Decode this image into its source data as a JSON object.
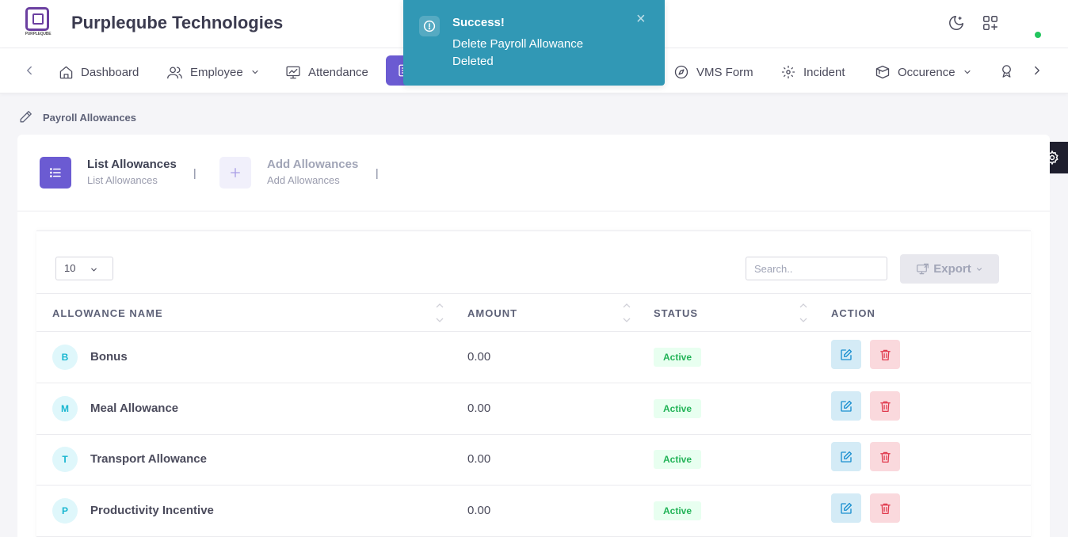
{
  "header": {
    "logo_text": "PURPLEQUBE",
    "company_name": "Purpleqube Technologies",
    "icons": [
      "moon-icon",
      "apps-grid-icon"
    ],
    "online_status_color": "#22c55e"
  },
  "nav": {
    "items": [
      {
        "label": "Dashboard",
        "icon": "home-icon",
        "has_dropdown": false
      },
      {
        "label": "Employee",
        "icon": "users-icon",
        "has_dropdown": true
      },
      {
        "label": "Attendance",
        "icon": "monitor-chart-icon",
        "has_dropdown": false
      },
      {
        "label": "",
        "icon": "payroll-icon",
        "active": true
      },
      {
        "label": "VMS Form",
        "icon": "compass-icon",
        "has_dropdown": false
      },
      {
        "label": "Incident",
        "icon": "scan-icon",
        "has_dropdown": false
      },
      {
        "label": "Occurence",
        "icon": "box-icon",
        "has_dropdown": true
      }
    ],
    "active_color": "#6b5bd2"
  },
  "toast": {
    "title": "Success!",
    "message": "Delete Payroll Allowance Deleted",
    "close": "×",
    "color": "#3198b5"
  },
  "breadcrumb": {
    "label": "Payroll Allowances"
  },
  "tabs": [
    {
      "title": "List Allowances",
      "subtitle": "List Allowances",
      "icon": "list-icon",
      "active": true
    },
    {
      "title": "Add Allowances",
      "subtitle": "Add Allowances",
      "icon": "plus-icon",
      "active": false
    }
  ],
  "tab_separator": "|",
  "table": {
    "page_length": "10",
    "search_placeholder": "Search..",
    "export_label": "Export",
    "columns": [
      "ALLOWANCE NAME",
      "AMOUNT",
      "STATUS",
      "ACTION"
    ],
    "rows": [
      {
        "initial": "B",
        "name": "Bonus",
        "amount": "0.00",
        "status": "Active"
      },
      {
        "initial": "M",
        "name": "Meal Allowance",
        "amount": "0.00",
        "status": "Active"
      },
      {
        "initial": "T",
        "name": "Transport Allowance",
        "amount": "0.00",
        "status": "Active"
      },
      {
        "initial": "P",
        "name": "Productivity Incentive",
        "amount": "0.00",
        "status": "Active"
      }
    ]
  }
}
